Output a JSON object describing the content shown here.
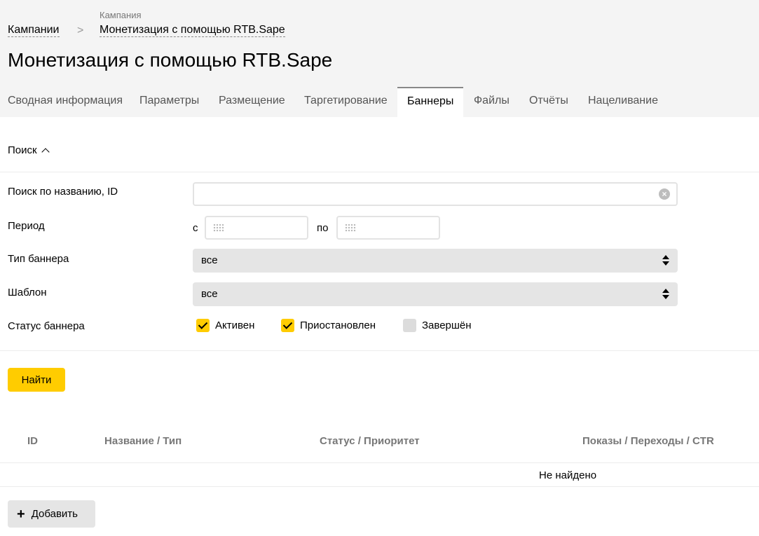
{
  "breadcrumb": {
    "caption": "Кампания",
    "root": "Кампании",
    "separator": ">",
    "current": "Монетизация с помощью RTB.Sape"
  },
  "page_title": "Монетизация с помощью RTB.Sape",
  "tabs": [
    {
      "label": "Сводная информация"
    },
    {
      "label": "Параметры"
    },
    {
      "label": "Размещение"
    },
    {
      "label": "Таргетирование"
    },
    {
      "label": "Баннеры",
      "active": true
    },
    {
      "label": "Файлы"
    },
    {
      "label": "Отчёты"
    },
    {
      "label": "Нацеливание"
    }
  ],
  "search": {
    "toggle_label": "Поиск",
    "name_label": "Поиск по названию, ID",
    "name_value": "",
    "period_label": "Период",
    "period_from_prefix": "с",
    "period_to_prefix": "по",
    "banner_type_label": "Тип баннера",
    "banner_type_value": "все",
    "template_label": "Шаблон",
    "template_value": "все",
    "status_label": "Статус баннера",
    "statuses": [
      {
        "label": "Активен",
        "checked": true
      },
      {
        "label": "Приостановлен",
        "checked": true
      },
      {
        "label": "Завершён",
        "checked": false
      }
    ],
    "find_button": "Найти"
  },
  "table": {
    "columns": [
      "ID",
      "Название / Тип",
      "Статус / Приоритет",
      "Показы / Переходы / CTR"
    ],
    "empty_text": "Не найдено"
  },
  "add_button": "Добавить",
  "colors": {
    "accent": "#ffcc00",
    "header_bg": "#f4f4f4"
  }
}
